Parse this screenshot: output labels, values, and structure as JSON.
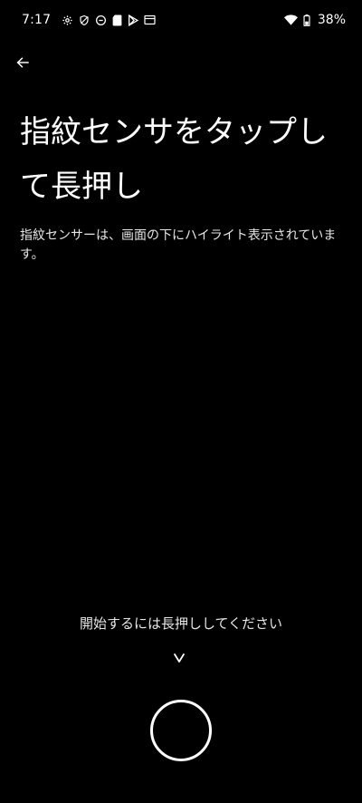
{
  "status_bar": {
    "time": "7:17",
    "left_icons": [
      "settings-icon",
      "shield-icon",
      "data-saver-icon",
      "sd-card-icon",
      "play-store-icon",
      "screen-cast-icon"
    ],
    "right_icons": [
      "wifi-icon",
      "battery-icon"
    ],
    "battery_percent": "38%"
  },
  "header": {
    "back_icon": "arrow-left-icon"
  },
  "main": {
    "title": "指紋センサをタップして長押し",
    "description": "指紋センサーは、画面の下にハイライト表示されています。"
  },
  "footer": {
    "start_hint": "開始するには長押ししてください",
    "chevron_icon": "chevron-down-icon",
    "fingerprint_target_icon": "circle-icon"
  },
  "colors": {
    "background": "#000000",
    "text": "#ffffff",
    "secondary_text": "#e6e6e6"
  }
}
